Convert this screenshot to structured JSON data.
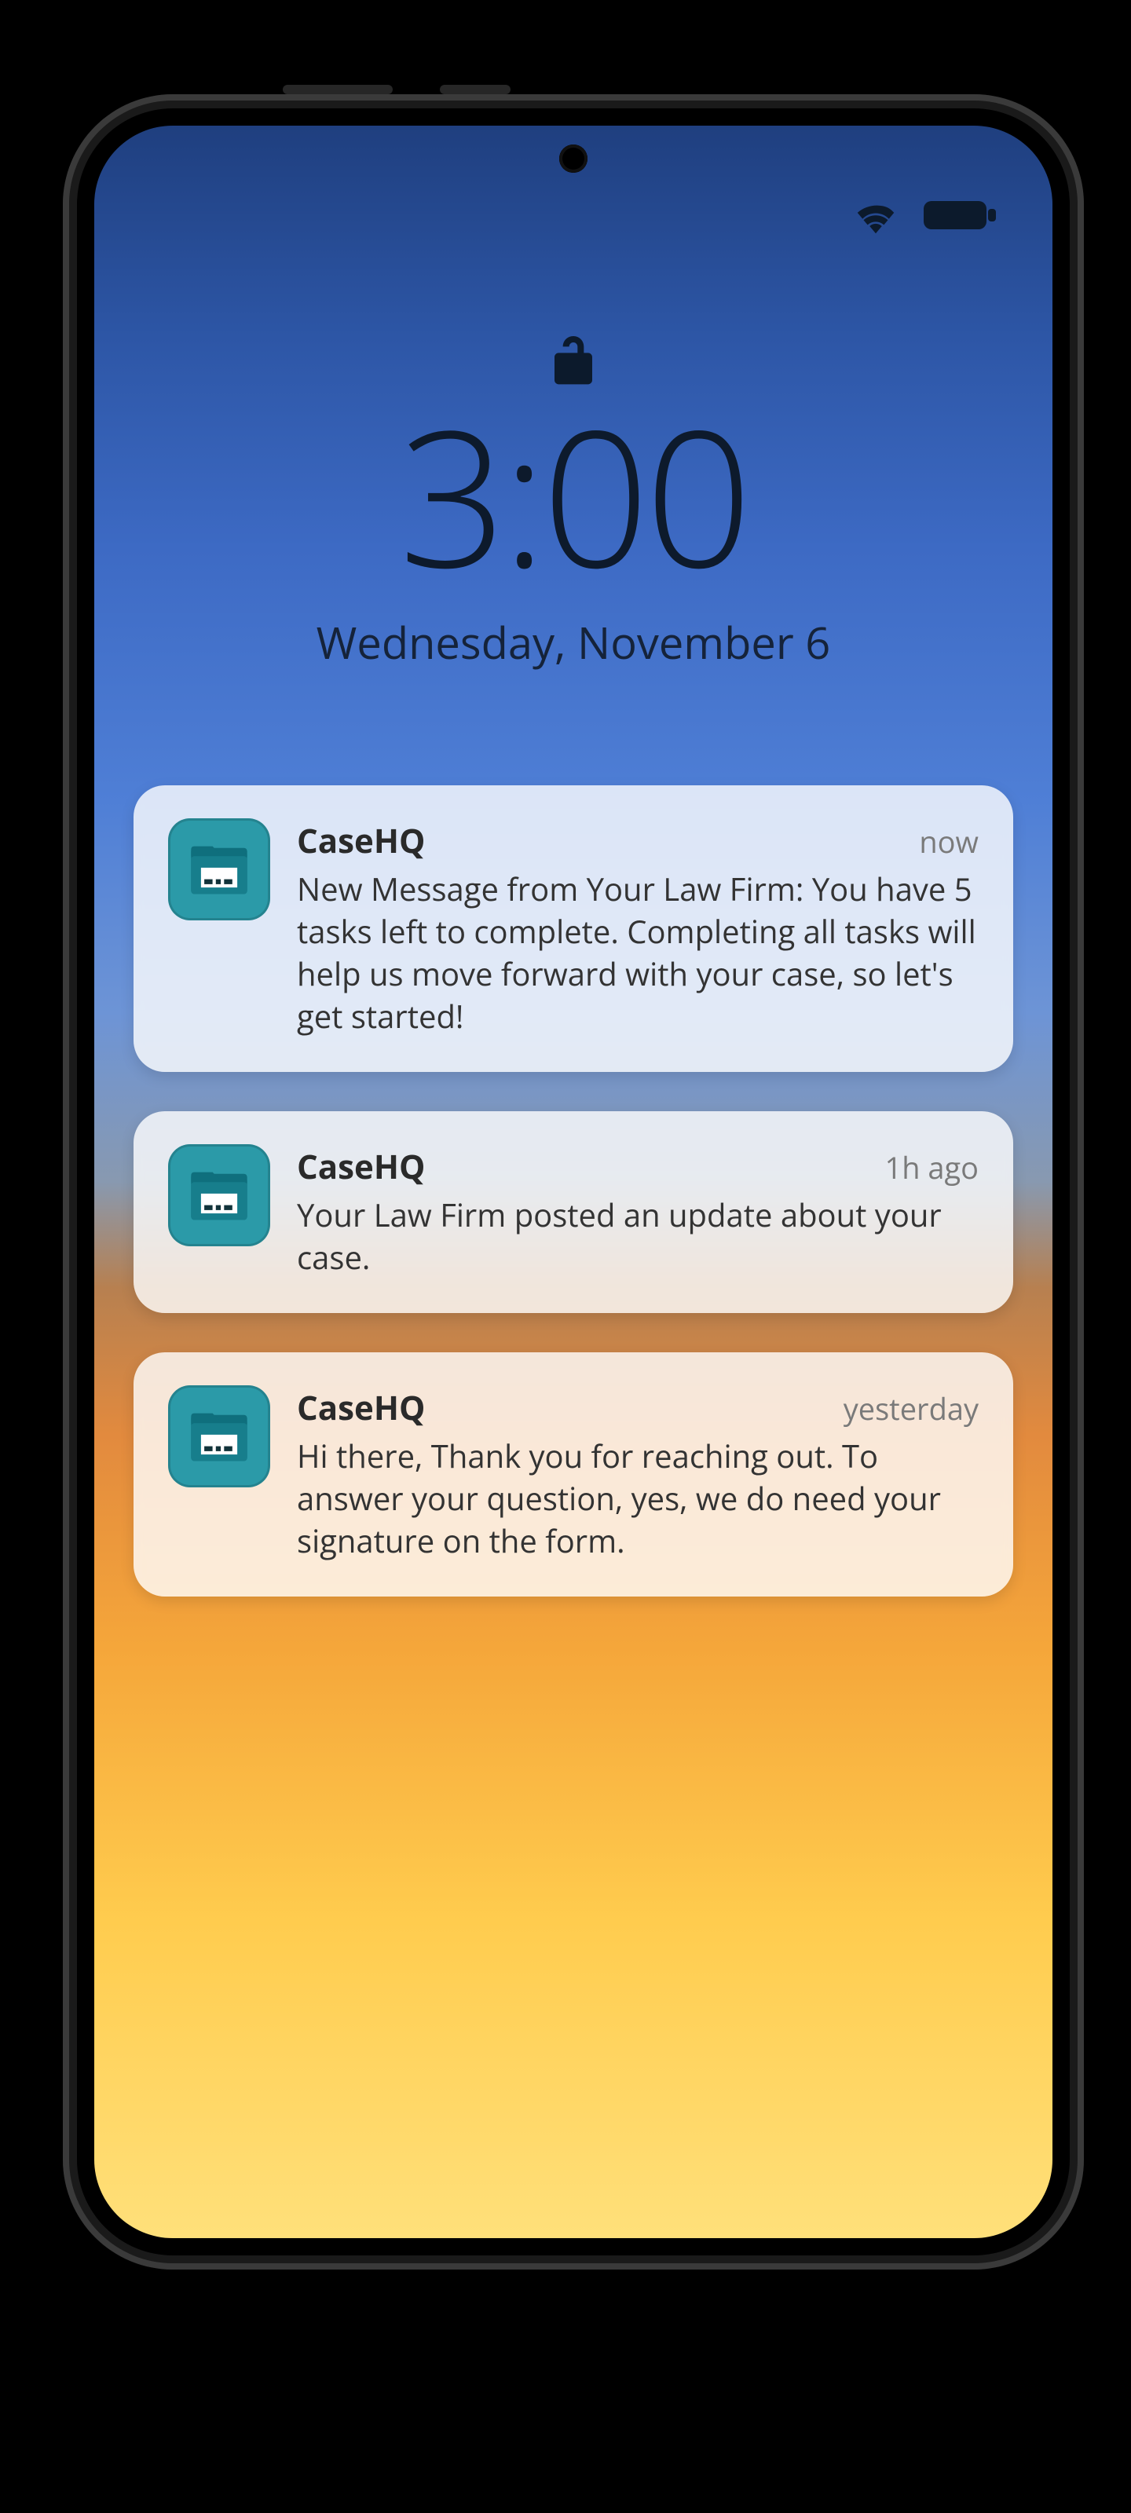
{
  "lockscreen": {
    "time": "3:00",
    "date": "Wednesday, November 6"
  },
  "notifications": [
    {
      "app": "CaseHQ",
      "when": "now",
      "message": "New Message from Your Law Firm: You have 5 tasks left to complete. Completing all tasks will help us move forward with your case, so let's get started!"
    },
    {
      "app": "CaseHQ",
      "when": "1h ago",
      "message": "Your Law Firm posted an update about your case."
    },
    {
      "app": "CaseHQ",
      "when": "yesterday",
      "message": "Hi there, Thank you for reaching out. To answer your question, yes, we do need your signature on the form."
    }
  ],
  "colors": {
    "app_icon_bg": "#2b9aa8",
    "text_dark": "#0d1a2c"
  }
}
